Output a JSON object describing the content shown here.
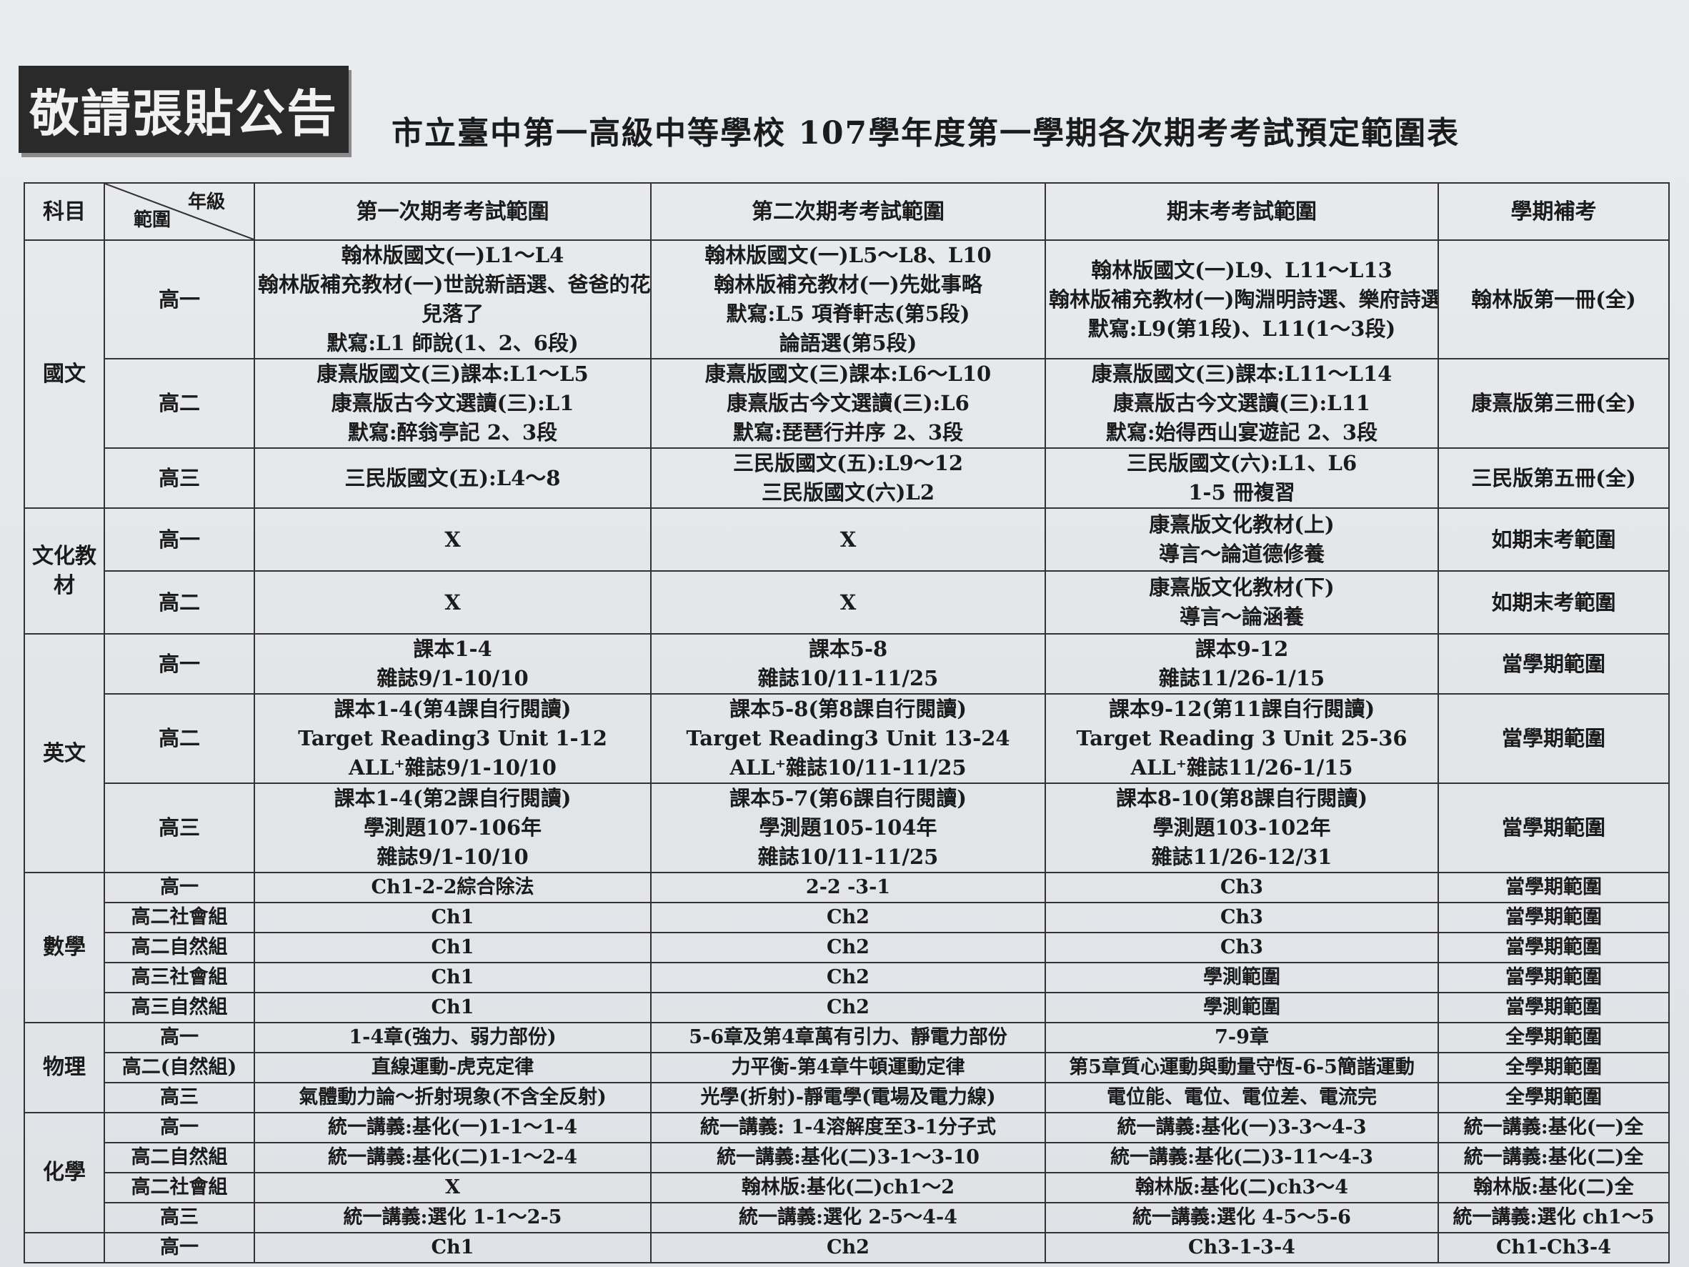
{
  "notice_label": "敬請張貼公告",
  "title": "市立臺中第一高級中等學校 107學年度第一學期各次期考考試預定範圍表",
  "header": {
    "subject": "科目",
    "grade": "年級",
    "scope": "範圍",
    "exam1": "第一次期考考試範圍",
    "exam2": "第二次期考考試範圍",
    "final": "期末考考試範圍",
    "makeup": "學期補考"
  },
  "rows": [
    {
      "subject": "國文",
      "grade": "高一",
      "exam1": [
        "翰林版國文(一)L1～L4",
        "翰林版補充教材(一)世說新語選、爸爸的花",
        "兒落了",
        "默寫:L1 師說(1、2、6段)"
      ],
      "exam2": [
        "翰林版國文(一)L5～L8、L10",
        "翰林版補充教材(一)先妣事略",
        "默寫:L5 項脊軒志(第5段)",
        "論語選(第5段)"
      ],
      "final": [
        "翰林版國文(一)L9、L11～L13",
        "翰林版補充教材(一)陶淵明詩選、樂府詩選",
        "默寫:L9(第1段)、L11(1～3段)"
      ],
      "makeup": [
        "翰林版第一冊(全)"
      ]
    },
    {
      "grade": "高二",
      "exam1": [
        "康熹版國文(三)課本:L1～L5",
        "康熹版古今文選讀(三):L1",
        "默寫:醉翁亭記 2、3段"
      ],
      "exam2": [
        "康熹版國文(三)課本:L6～L10",
        "康熹版古今文選讀(三):L6",
        "默寫:琵琶行并序 2、3段"
      ],
      "final": [
        "康熹版國文(三)課本:L11～L14",
        "康熹版古今文選讀(三):L11",
        "默寫:始得西山宴遊記 2、3段"
      ],
      "makeup": [
        "康熹版第三冊(全)"
      ]
    },
    {
      "grade": "高三",
      "exam1": [
        "三民版國文(五):L4～8"
      ],
      "exam2": [
        "三民版國文(五):L9～12",
        "三民版國文(六)L2"
      ],
      "final": [
        "三民版國文(六):L1、L6",
        "1-5 冊複習"
      ],
      "makeup": [
        "三民版第五冊(全)"
      ]
    },
    {
      "subject": "文化教材",
      "grade": "高一",
      "exam1": [
        "X"
      ],
      "exam2": [
        "X"
      ],
      "final": [
        "康熹版文化教材(上)",
        "導言～論道德修養"
      ],
      "makeup": [
        "如期末考範圍"
      ]
    },
    {
      "grade": "高二",
      "exam1": [
        "X"
      ],
      "exam2": [
        "X"
      ],
      "final": [
        "康熹版文化教材(下)",
        "導言～論涵養"
      ],
      "makeup": [
        "如期末考範圍"
      ]
    },
    {
      "subject": "英文",
      "grade": "高一",
      "exam1": [
        "課本1-4",
        "雜誌9/1-10/10"
      ],
      "exam2": [
        "課本5-8",
        "雜誌10/11-11/25"
      ],
      "final": [
        "課本9-12",
        "雜誌11/26-1/15"
      ],
      "makeup": [
        "當學期範圍"
      ]
    },
    {
      "grade": "高二",
      "exam1": [
        "課本1-4(第4課自行閱讀)",
        "Target Reading3 Unit 1-12",
        "ALL⁺雜誌9/1-10/10"
      ],
      "exam2": [
        "課本5-8(第8課自行閱讀)",
        "Target Reading3 Unit 13-24",
        "ALL⁺雜誌10/11-11/25"
      ],
      "final": [
        "課本9-12(第11課自行閱讀)",
        "Target Reading 3 Unit 25-36",
        "ALL⁺雜誌11/26-1/15"
      ],
      "makeup": [
        "當學期範圍"
      ]
    },
    {
      "grade": "高三",
      "exam1": [
        "課本1-4(第2課自行閱讀)",
        "學測題107-106年",
        "雜誌9/1-10/10"
      ],
      "exam2": [
        "課本5-7(第6課自行閱讀)",
        "學測題105-104年",
        "雜誌10/11-11/25"
      ],
      "final": [
        "課本8-10(第8課自行閱讀)",
        "學測題103-102年",
        "雜誌11/26-12/31"
      ],
      "makeup": [
        "當學期範圍"
      ]
    },
    {
      "subject": "數學",
      "grade": "高一",
      "exam1": [
        "Ch1-2-2綜合除法"
      ],
      "exam2": [
        "2-2 -3-1"
      ],
      "final": [
        "Ch3"
      ],
      "makeup": [
        "當學期範圍"
      ]
    },
    {
      "grade": "高二社會組",
      "exam1": [
        "Ch1"
      ],
      "exam2": [
        "Ch2"
      ],
      "final": [
        "Ch3"
      ],
      "makeup": [
        "當學期範圍"
      ]
    },
    {
      "grade": "高二自然組",
      "exam1": [
        "Ch1"
      ],
      "exam2": [
        "Ch2"
      ],
      "final": [
        "Ch3"
      ],
      "makeup": [
        "當學期範圍"
      ]
    },
    {
      "grade": "高三社會組",
      "exam1": [
        "Ch1"
      ],
      "exam2": [
        "Ch2"
      ],
      "final": [
        "學測範圍"
      ],
      "makeup": [
        "當學期範圍"
      ]
    },
    {
      "grade": "高三自然組",
      "exam1": [
        "Ch1"
      ],
      "exam2": [
        "Ch2"
      ],
      "final": [
        "學測範圍"
      ],
      "makeup": [
        "當學期範圍"
      ]
    },
    {
      "subject": "物理",
      "grade": "高一",
      "exam1": [
        "1-4章(強力、弱力部份)"
      ],
      "exam2": [
        "5-6章及第4章萬有引力、靜電力部份"
      ],
      "final": [
        "7-9章"
      ],
      "makeup": [
        "全學期範圍"
      ]
    },
    {
      "grade": "高二(自然組)",
      "exam1": [
        "直線運動-虎克定律"
      ],
      "exam2": [
        "力平衡-第4章牛頓運動定律"
      ],
      "final": [
        "第5章質心運動與動量守恆-6-5簡諧運動"
      ],
      "makeup": [
        "全學期範圍"
      ]
    },
    {
      "grade": "高三",
      "exam1": [
        "氣體動力論～折射現象(不含全反射)"
      ],
      "exam2": [
        "光學(折射)-靜電學(電場及電力線)"
      ],
      "final": [
        "電位能、電位、電位差、電流完"
      ],
      "makeup": [
        "全學期範圍"
      ]
    },
    {
      "subject": "化學",
      "grade": "高一",
      "exam1": [
        "統一講義:基化(一)1-1～1-4"
      ],
      "exam2": [
        "統一講義: 1-4溶解度至3-1分子式"
      ],
      "final": [
        "統一講義:基化(一)3-3～4-3"
      ],
      "makeup": [
        "統一講義:基化(一)全"
      ]
    },
    {
      "grade": "高二自然組",
      "exam1": [
        "統一講義:基化(二)1-1～2-4"
      ],
      "exam2": [
        "統一講義:基化(二)3-1～3-10"
      ],
      "final": [
        "統一講義:基化(二)3-11～4-3"
      ],
      "makeup": [
        "統一講義:基化(二)全"
      ]
    },
    {
      "grade": "高二社會組",
      "exam1": [
        "X"
      ],
      "exam2": [
        "翰林版:基化(二)ch1～2"
      ],
      "final": [
        "翰林版:基化(二)ch3～4"
      ],
      "makeup": [
        "翰林版:基化(二)全"
      ]
    },
    {
      "grade": "高三",
      "exam1": [
        "統一講義:選化 1-1～2-5"
      ],
      "exam2": [
        "統一講義:選化 2-5～4-4"
      ],
      "final": [
        "統一講義:選化 4-5～5-6"
      ],
      "makeup": [
        "統一講義:選化 ch1～5"
      ]
    },
    {
      "grade": "高一",
      "exam1": [
        "Ch1"
      ],
      "exam2": [
        "Ch2"
      ],
      "final": [
        "Ch3-1-3-4"
      ],
      "makeup": [
        "Ch1-Ch3-4"
      ]
    }
  ]
}
